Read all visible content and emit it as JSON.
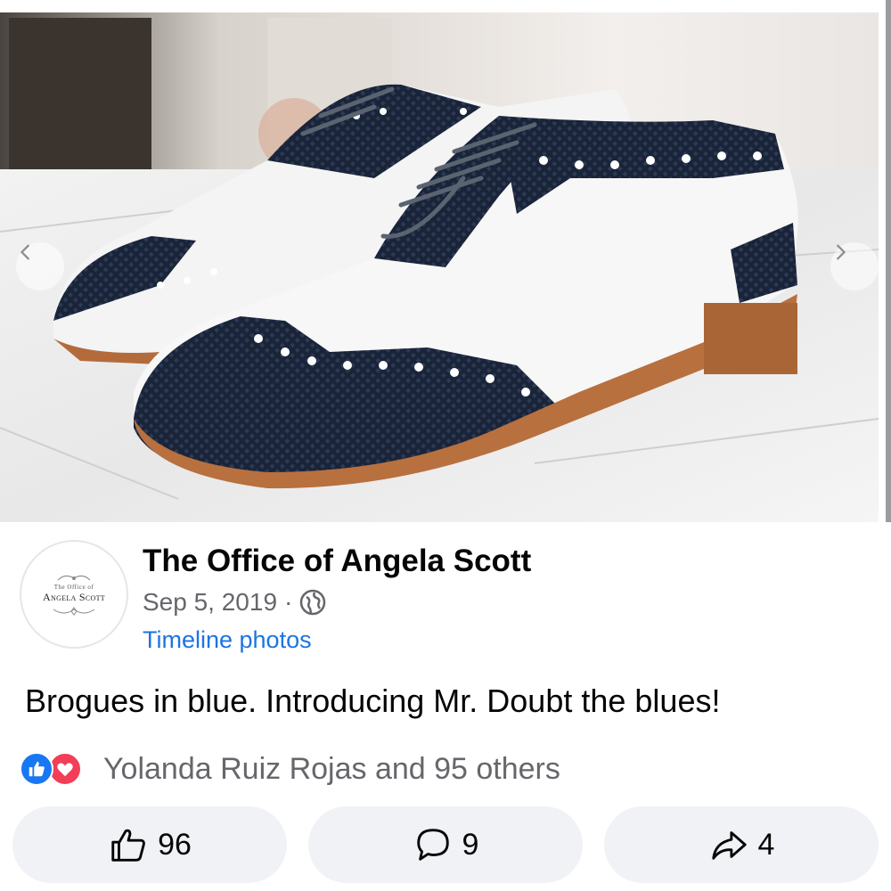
{
  "post": {
    "page_name": "The Office of Angela Scott",
    "date": "Sep 5, 2019",
    "separator": "·",
    "privacy_icon": "globe-icon",
    "album": "Timeline photos",
    "text": "Brogues in blue. Introducing Mr. Doubt the blues!",
    "avatar": {
      "logo_top": "The Office of",
      "logo_name": "Angela Scott"
    }
  },
  "photo": {
    "subject": "photo",
    "prev_icon": "chevron-left-icon",
    "next_icon": "chevron-right-icon"
  },
  "reactions": {
    "icons": [
      "like-reaction-icon",
      "love-reaction-icon"
    ],
    "summary": "Yolanda Ruiz Rojas and 95 others"
  },
  "actions": {
    "like": {
      "icon": "thumbs-up-icon",
      "count": "96"
    },
    "comment": {
      "icon": "comment-bubble-icon",
      "count": "9"
    },
    "share": {
      "icon": "share-arrow-icon",
      "count": "4"
    }
  },
  "colors": {
    "link": "#1b74e4",
    "secondary_text": "#65676b",
    "button_bg": "#f0f2f5",
    "like_blue": "#1877f2",
    "love_red": "#f33e58"
  }
}
